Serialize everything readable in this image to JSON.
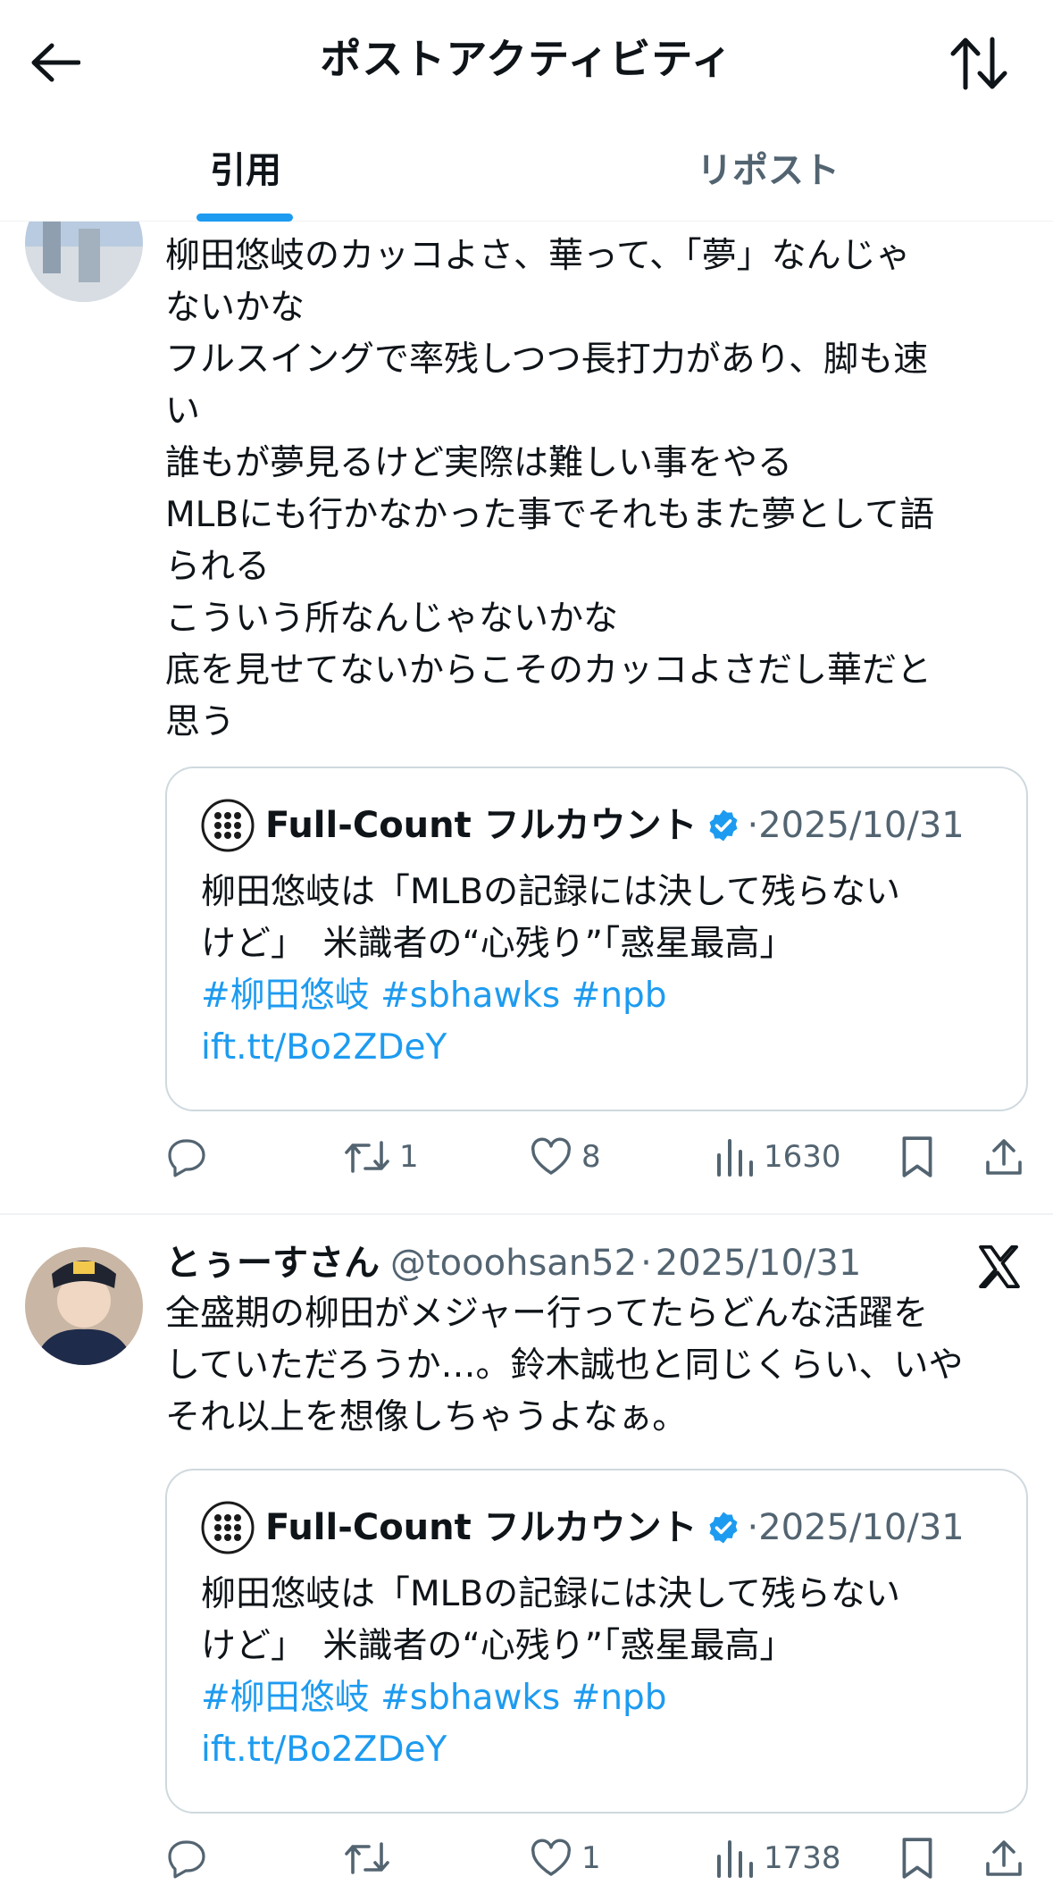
{
  "header": {
    "title": "ポストアクティビティ"
  },
  "tabs": [
    {
      "label": "引用",
      "active": true
    },
    {
      "label": "リポスト",
      "active": false
    }
  ],
  "quoted": {
    "name": "Full-Count フルカウント",
    "date": "2025/10/31",
    "dot": "·",
    "text": "柳田悠岐は「MLBの記録には決して残らない\nけど」　米識者の“心残り”「惑星最高」",
    "tags": "#柳田悠岐 #sbhawks #npb",
    "link": "ift.tt/Bo2ZDeY"
  },
  "posts": [
    {
      "text": "柳田悠岐のカッコよさ、華って、「夢」なんじゃ\nないかな\nフルスイングで率残しつつ長打力があり、脚も速\nい\n誰もが夢見るけど実際は難しい事をやる\nMLBにも行かなかった事でそれもまた夢として語\nられる\nこういう所なんじゃないかな\n底を見せてないからこそのカッコよさだし華だと\n思う",
      "stats": {
        "retweets": "1",
        "likes": "8",
        "views": "1630"
      }
    },
    {
      "author": "とぅーすさん",
      "handle": "@tooohsan52",
      "dot": "·",
      "date": "2025/10/31",
      "text": "全盛期の柳田がメジャー行ってたらどんな活躍を\nしていただろうか…。鈴木誠也と同じくらい、いや\nそれ以上を想像しちゃうよなぁ。",
      "stats": {
        "retweets": "",
        "likes": "1",
        "views": "1738"
      }
    }
  ],
  "colors": {
    "accent": "#1d9bf0",
    "text": "#0f1419",
    "secondary": "#536471",
    "border": "#cfd9de"
  },
  "icons": {
    "back": "arrow-left-icon",
    "sort": "sort-arrows-icon",
    "reply": "reply-icon",
    "retweet": "retweet-icon",
    "like": "heart-icon",
    "views": "views-icon",
    "bookmark": "bookmark-icon",
    "share": "share-icon",
    "source": "x-logo-icon"
  }
}
